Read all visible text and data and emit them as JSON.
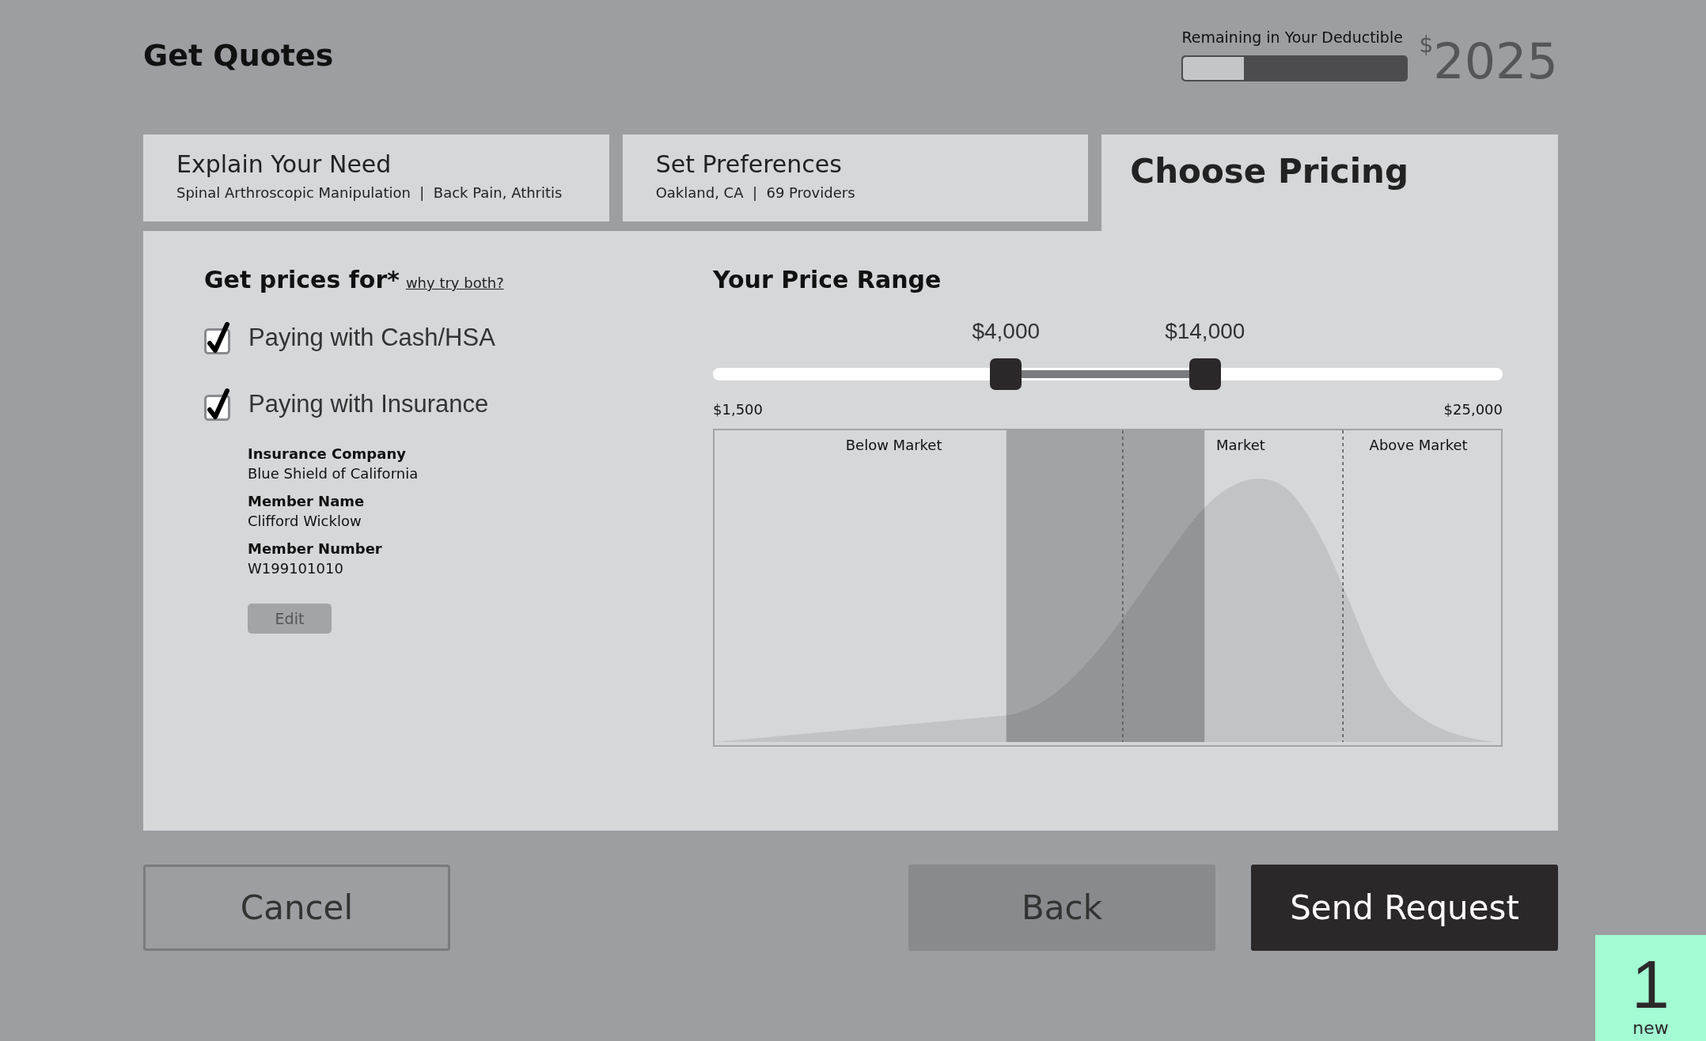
{
  "header": {
    "title": "Get Quotes",
    "deductible": {
      "label": "Remaining in Your Deductible",
      "level": 0.27,
      "currency": "$",
      "amount": "2025"
    }
  },
  "tabs": [
    {
      "title": "Explain Your Need",
      "subtitle": "Spinal Arthroscopic Manipulation  |  Back Pain, Athritis",
      "selected": false
    },
    {
      "title": "Set Preferences",
      "subtitle": "Oakland, CA  |  69 Providers",
      "selected": false
    },
    {
      "title": "Choose Pricing",
      "selected": true
    }
  ],
  "prices_for": {
    "heading": "Get prices for*",
    "link": "why try both?",
    "options": [
      {
        "label": "Paying with Cash/HSA",
        "checked": true
      },
      {
        "label": "Paying with Insurance",
        "checked": true
      }
    ],
    "insurance_fields": [
      {
        "label": "Insurance Company",
        "value": "Blue Shield of California"
      },
      {
        "label": "Member Name",
        "value": "Clifford Wicklow"
      },
      {
        "label": "Member Number",
        "value": "W199101010"
      }
    ],
    "edit_button": "Edit"
  },
  "price_range": {
    "heading": "Your Price Range",
    "thumbs": [
      {
        "label": "$4,000",
        "level": 0.371
      },
      {
        "label": "$14,000",
        "level": 0.623
      }
    ],
    "min_label": "$1,500",
    "max_label": "$25,000",
    "regions": [
      "Below Market",
      "Market",
      "Above Market"
    ]
  },
  "buttons": {
    "cancel": "Cancel",
    "back": "Back",
    "send": "Send Request"
  },
  "badge": {
    "count": "1",
    "label": "new"
  }
}
